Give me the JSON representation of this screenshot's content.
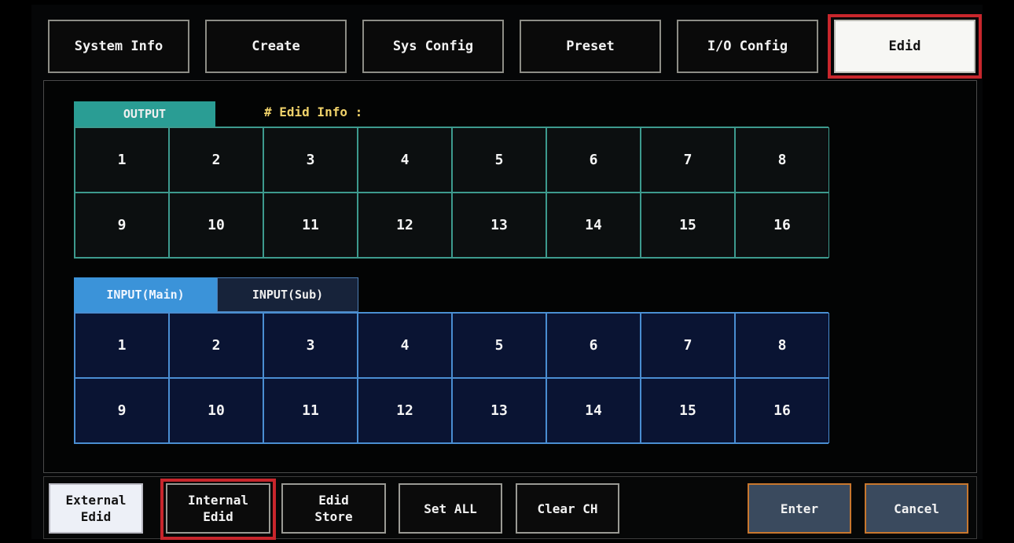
{
  "top_nav": {
    "items": [
      {
        "label": "System Info"
      },
      {
        "label": "Create"
      },
      {
        "label": "Sys Config"
      },
      {
        "label": "Preset"
      },
      {
        "label": "I/O Config"
      },
      {
        "label": "Edid"
      }
    ],
    "active": "Edid"
  },
  "output_section": {
    "tab_label": "OUTPUT",
    "info_label": "# Edid Info :",
    "channels": [
      "1",
      "2",
      "3",
      "4",
      "5",
      "6",
      "7",
      "8",
      "9",
      "10",
      "11",
      "12",
      "13",
      "14",
      "15",
      "16"
    ]
  },
  "input_section": {
    "tabs": [
      {
        "label": "INPUT(Main)",
        "active": true
      },
      {
        "label": "INPUT(Sub)",
        "active": false
      }
    ],
    "channels": [
      "1",
      "2",
      "3",
      "4",
      "5",
      "6",
      "7",
      "8",
      "9",
      "10",
      "11",
      "12",
      "13",
      "14",
      "15",
      "16"
    ]
  },
  "bottom_bar": {
    "buttons": [
      {
        "line1": "External",
        "line2": "Edid"
      },
      {
        "line1": "Internal",
        "line2": "Edid"
      },
      {
        "line1": "Edid",
        "line2": "Store"
      },
      {
        "line1": "Set ALL",
        "line2": ""
      },
      {
        "line1": "Clear CH",
        "line2": ""
      },
      {
        "line1": "Enter",
        "line2": ""
      },
      {
        "line1": "Cancel",
        "line2": ""
      }
    ],
    "selected": "Internal Edid"
  },
  "colors": {
    "output_accent": "#2a9d94",
    "input_accent": "#3b93d9",
    "selection_highlight": "#c8262c",
    "action_border": "#c8772e"
  }
}
